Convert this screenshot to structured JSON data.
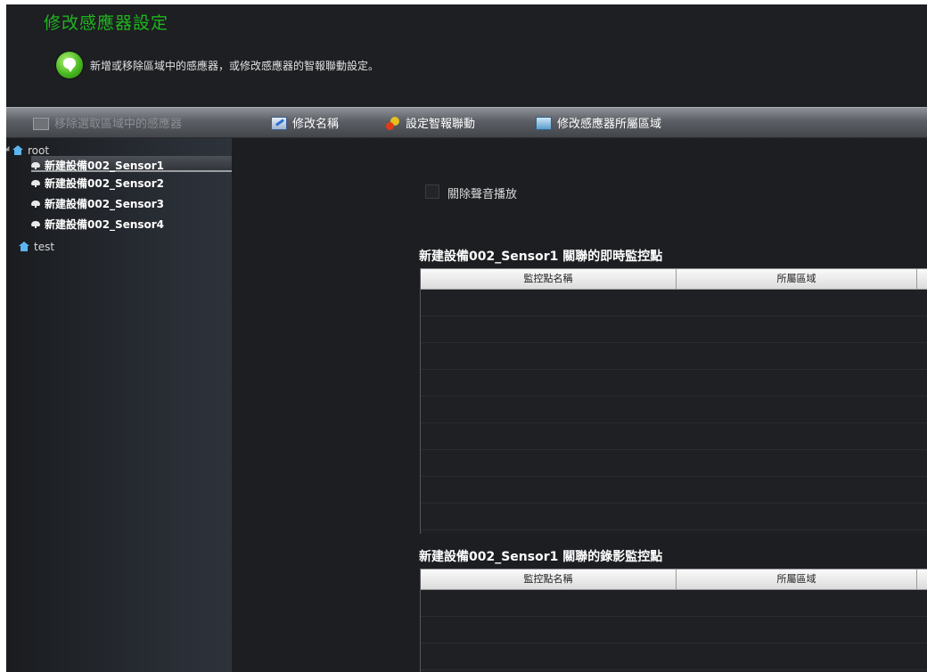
{
  "header": {
    "title": "修改感應器設定",
    "info_icon": "info-bubble-icon",
    "info_text": "新增或移除區域中的感應器，或修改感應器的智報聯動設定。"
  },
  "toolbar": {
    "items": [
      {
        "label": "移除選取區域中的感應器",
        "icon": "remove-sensor-icon",
        "enabled": false
      },
      {
        "label": "修改名稱",
        "icon": "edit-name-icon",
        "enabled": true
      },
      {
        "label": "設定智報聯動",
        "icon": "alarm-link-icon",
        "enabled": true
      },
      {
        "label": "修改感應器所屬區域",
        "icon": "change-area-icon",
        "enabled": true
      }
    ]
  },
  "tree": {
    "nodes": [
      {
        "label": "root",
        "type": "area",
        "expanded": true
      },
      {
        "label": "新建設備002_Sensor1",
        "type": "sensor",
        "selected": true
      },
      {
        "label": "新建設備002_Sensor2",
        "type": "sensor"
      },
      {
        "label": "新建設備002_Sensor3",
        "type": "sensor"
      },
      {
        "label": "新建設備002_Sensor4",
        "type": "sensor"
      },
      {
        "label": "test",
        "type": "area"
      }
    ]
  },
  "content": {
    "mute_checkbox": {
      "label": "關除聲音播放",
      "checked": false
    },
    "live_section": {
      "title": "新建設備002_Sensor1 關聯的即時監控點",
      "columns": [
        "監控點名稱",
        "所屬區域"
      ]
    },
    "record_section": {
      "title": "新建設備002_Sensor1 關聯的錄影監控點",
      "columns": [
        "監控點名稱",
        "所屬區域"
      ]
    }
  },
  "colors": {
    "title_green": "#1fb51f",
    "panel_bg": "#1c1e21",
    "tree_bg": "#262a31"
  }
}
